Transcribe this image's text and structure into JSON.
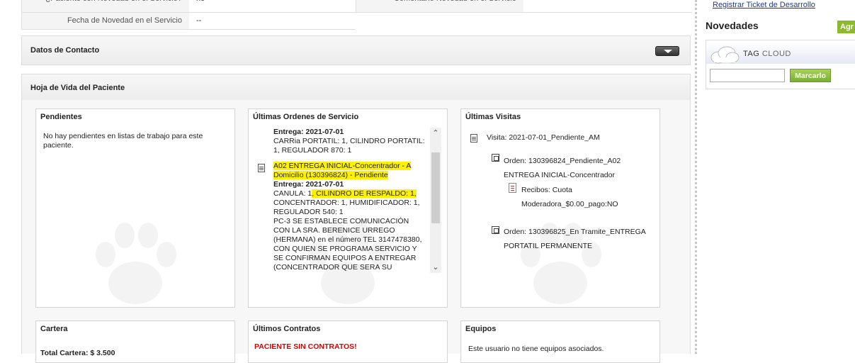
{
  "info_rows": {
    "novedad_label": "¿Paciente con Novedad en el Servicio?",
    "novedad_value": "no",
    "comentario_label": "Comentario Novedad en el Servicio",
    "fecha_label": "Fecha de Novedad en el Servicio",
    "fecha_value": "--"
  },
  "sections": {
    "contacto": "Datos de Contacto",
    "hoja_vida": "Hoja de Vida del Paciente"
  },
  "pendientes": {
    "title": "Pendientes",
    "text": "No hay pendientes en listas de trabajo para este paciente."
  },
  "ordenes": {
    "title": "Últimas Ordenes de Servicio",
    "entries": [
      {
        "line_entrega": "Entrega: 2021-07-01",
        "line_items": "CARRia PORTATIL: 1, CILINDRO PORTATIL: 1, REGULADOR 870: 1"
      },
      {
        "order_title": "A02 ENTREGA INICIAL-Concentrador - A Domicilio (130396824) - Pendiente",
        "line_entrega": "Entrega: 2021-07-01",
        "line_items_a": "CANULA: 1",
        "line_items_b": ", CILINDRO DE RESPALDO: 1,",
        "line_items_c": "CONCENTRADOR: 1, HUMIDIFICADOR: 1, REGULADOR 540: 1",
        "notes": "PC-3 SE ESTABLECE COMUNICACIÓN CON LA SRA. BERENICE URREGO (HERMANA) en el número TEL 3147478380, CON QUIEN SE PROGRAMA SERVICIO Y SE CONFIRMAN EQUIPOS A ENTREGAR (CONCENTRADOR QUE SERA SU PRINCIPAL"
      }
    ]
  },
  "visitas": {
    "title": "Últimas Visitas",
    "visit": "Visita: 2021-07-01_Pendiente_AM",
    "orden1": "Orden: 130396824_Pendiente_A02 ENTREGA INICIAL-Concentrador",
    "recibo": "Recibos: Cuota Moderadora_$0.00_pago:NO",
    "orden2": "Orden: 130396825_En Tramite_ENTREGA PORTATIL PERMANENTE"
  },
  "cartera": {
    "title": "Cartera",
    "total": "Total Cartera: $ 3.500"
  },
  "contratos": {
    "title": "Últimos Contratos",
    "message": "PACIENTE SIN CONTRATOS!"
  },
  "equipos": {
    "title": "Equipos",
    "message": "Este usuario no tiene equipos asociados."
  },
  "sidebar": {
    "ticket_link": "Registrar Ticket de Desarrollo",
    "novedades_title": "Novedades",
    "agr_button": "Agr",
    "tag_word": "TAG",
    "cloud_word": "CLOUD",
    "marcarlo_button": "Marcarlo"
  },
  "colors": {
    "highlight": "#fff200",
    "link": "#233a7c",
    "button_green": "#8bbb2c",
    "alert_red": "#e00000"
  }
}
